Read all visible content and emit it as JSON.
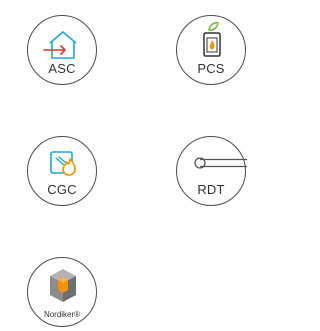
{
  "badges": [
    {
      "id": "asc",
      "label": "ASC",
      "icon": "house-arrow-icon"
    },
    {
      "id": "pcs",
      "label": "PCS",
      "icon": "stove-leaf-icon"
    },
    {
      "id": "cgc",
      "label": "CGC",
      "icon": "glass-flame-icon"
    },
    {
      "id": "rdt",
      "label": "RDT",
      "icon": "door-handle-icon"
    },
    {
      "id": "nor",
      "label": "Nordiker®",
      "icon": "nordiker-cube-logo"
    }
  ],
  "colors": {
    "outline": "#4d4d4d",
    "accent_blue": "#1ba9d8",
    "accent_red": "#e2342a",
    "accent_orange": "#f39200",
    "accent_green": "#6bb43a",
    "logo_gray": "#8c8c8c"
  }
}
